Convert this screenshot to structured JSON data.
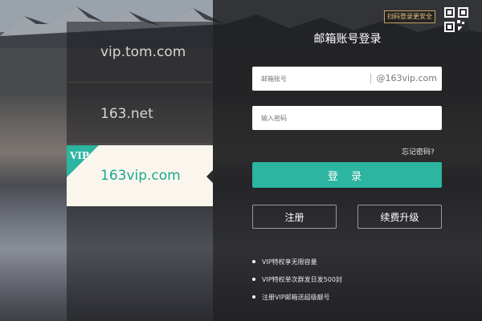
{
  "qr_tip": "扫码登录更安全",
  "providers": [
    {
      "label": "vip.tom.com",
      "selected": false
    },
    {
      "label": "163.net",
      "selected": false
    },
    {
      "label": "163vip.com",
      "selected": true,
      "badge": "VIP"
    }
  ],
  "login": {
    "title": "邮箱账号登录",
    "username_placeholder": "邮箱账号",
    "username_value": "",
    "domain_suffix": "@163vip.com",
    "password_placeholder": "输入密码",
    "password_value": "",
    "forgot_label": "忘记密码?",
    "login_button": "登 录",
    "register_button": "注册",
    "renew_button": "续费升级"
  },
  "benefits": [
    "VIP特权享无限容量",
    "VIP特权单次群发日发500封",
    "注册VIP邮箱送超级靓号"
  ],
  "colors": {
    "accent": "#2cb5a0",
    "selected_provider_bg": "#fbf6ed",
    "qr_tip_border": "#c9a25a"
  }
}
